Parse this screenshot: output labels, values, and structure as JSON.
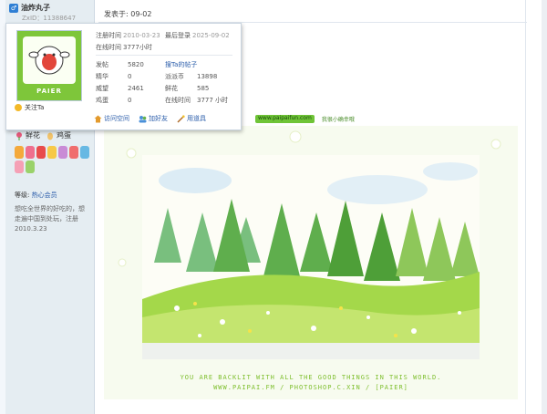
{
  "user": {
    "name": "油炸丸子",
    "uid": "ZxID：11388647",
    "flowers_label": "鲜花",
    "eggs_label": "鸡蛋",
    "level_label": "等级:",
    "level_value": "热心会员",
    "signature": "想吃全世界的好吃的，想走遍中国到处玩，注册2010.3.23"
  },
  "popup": {
    "avatar_brand": "PAIER",
    "follow_label": "关注Ta",
    "register_label": "注册时间",
    "register_value": "2010-03-23",
    "last_login_label": "最后登录",
    "last_login_value": "2025-09-02",
    "online_label": "在线时间",
    "online_value": "3777小时",
    "stats": [
      {
        "k": "发帖",
        "v": "5820",
        "k2": "搜Ta的帖子",
        "v2": ""
      },
      {
        "k": "精华",
        "v": "0",
        "k2": "派派币",
        "v2": "13898"
      },
      {
        "k": "威望",
        "v": "2461",
        "k2": "鲜花",
        "v2": "585"
      },
      {
        "k": "鸡蛋",
        "v": "0",
        "k2": "在线时间",
        "v2": "3777 小时"
      }
    ],
    "actions": {
      "visit": "访问空间",
      "add_friend": "加好友",
      "use_tool": "用道具"
    }
  },
  "post": {
    "date": "发表于: 09-02",
    "mini_link_1": "www.paipaifun.com",
    "mini_link_2": "我很小确幸哦",
    "caption_1": "YOU ARE BACKLIT WITH ALL THE GOOD THINGS IN THIS WORLD.",
    "caption_2": "WWW.PAIPAI.FM / PHOTOSHOP.C.XIN / [PAIER]"
  },
  "colors": {
    "link": "#2a5caa",
    "accent_green": "#7ec63a"
  }
}
